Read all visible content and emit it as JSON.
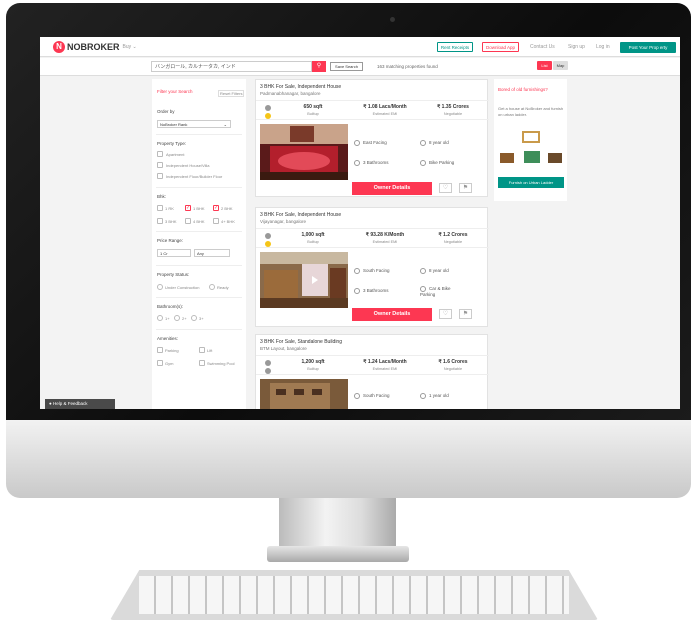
{
  "brand": {
    "logo_letter": "N",
    "name": "NOBROKER",
    "city_hint": "Buy ⌄",
    "accent": "#fd3752"
  },
  "topbar": {
    "rent_receipts": "Rent Receipts",
    "download_app": "Download App",
    "contact_us": "Contact Us",
    "sign_up": "Sign up",
    "log_in": "Log in",
    "post_property": "Post Your Prop erty"
  },
  "search": {
    "value": "バンガロール, カルナータカ, インド",
    "button_icon": "search-icon",
    "save_search": "Save Search",
    "match_text": "163 matching properties found",
    "tab_list": "List",
    "tab_map": "Map"
  },
  "filters": {
    "filter_title": "Filter your Search",
    "reset": "Reset Filters",
    "order_by_label": "Order by",
    "order_by_value": "NoBroker Rank",
    "property_type_label": "Property Type:",
    "property_types": [
      "Apartment",
      "Independent House/Villa",
      "Independent Floor/Builder Floor"
    ],
    "bhk_label": "Bhk:",
    "bhk_options": [
      "1 RK",
      "1 BHK",
      "2 BHK",
      "3 BHK",
      "4 BHK",
      "4+ BHK"
    ],
    "price_label": "Price Range:",
    "price_min": "1 Cr",
    "price_max": "Any",
    "status_label": "Property Status:",
    "status_options": [
      "Under Construction",
      "Ready"
    ],
    "bathroom_label": "Bathroom(s):",
    "bathroom_options": [
      "1+",
      "2+",
      "3+"
    ],
    "amenities_label": "Amenities:",
    "amenities": [
      "Parking",
      "Lift",
      "Gym",
      "Swimming Pool"
    ]
  },
  "listings": [
    {
      "title": "3 BHK For Sale, Independent House",
      "locality": "Padmanabhanagar, bangalore",
      "area": "650 sqft",
      "area_sub": "Builtup",
      "emi": "₹ 1.08 Lacs/Month",
      "emi_sub": "Estimated EMI",
      "price": "₹ 1.35 Crores",
      "price_sub": "Negotiable",
      "f1": "East Facing",
      "f2": "8 year old",
      "f3": "3 Bathrooms",
      "f4": "Bike Parking",
      "cta": "Owner Details"
    },
    {
      "title": "3 BHK For Sale, Independent House",
      "locality": "Vijayanagar, bangalore",
      "area": "1,000 sqft",
      "area_sub": "Builtup",
      "emi": "₹ 93.28 K/Month",
      "emi_sub": "Estimated EMI",
      "price": "₹ 1.2 Crores",
      "price_sub": "Negotiable",
      "f1": "South Facing",
      "f2": "8 year old",
      "f3": "3 Bathrooms",
      "f4": "Car & Bike Parking",
      "cta": "Owner Details"
    },
    {
      "title": "3 BHK For Sale, Standalone Building",
      "locality": "BTM Layout, bangalore",
      "area": "1,200 sqft",
      "area_sub": "Builtup",
      "emi": "₹ 1.24 Lacs/Month",
      "emi_sub": "Estimated EMI",
      "price": "₹ 1.6 Crores",
      "price_sub": "Negotiable",
      "f1": "South Facing",
      "f2": "1 year old"
    }
  ],
  "promo": {
    "title": "Bored of old furnishings?",
    "body": "Get a house at NoBroker and furnish on urban ladder.",
    "button": "Furnish on Urban Ladder"
  },
  "help": "Help & Feedback"
}
